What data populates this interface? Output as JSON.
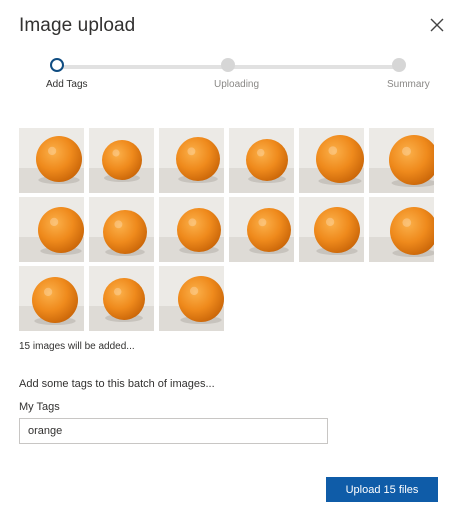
{
  "dialog": {
    "title": "Image upload",
    "close_icon": "close-icon"
  },
  "steps": [
    {
      "label": "Add Tags",
      "state": "active"
    },
    {
      "label": "Uploading",
      "state": "pending"
    },
    {
      "label": "Summary",
      "state": "pending"
    }
  ],
  "images": {
    "count": 15,
    "subject": "orange",
    "status": "15 images will be added..."
  },
  "tags": {
    "prompt": "Add some tags to this batch of images...",
    "label": "My Tags",
    "value": "orange"
  },
  "actions": {
    "upload_label": "Upload 15 files"
  },
  "colors": {
    "accent": "#0f5ca8",
    "active_step": "#0f4c81",
    "orange": "#ee8a1a"
  }
}
